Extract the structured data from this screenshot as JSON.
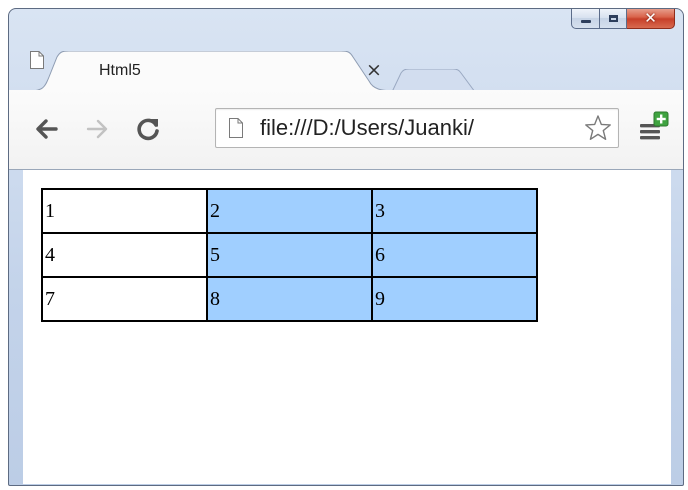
{
  "window": {
    "buttons": {
      "minimize": "minimize",
      "maximize": "maximize",
      "close": "close"
    }
  },
  "tab": {
    "title": "Html5",
    "close_glyph": "×",
    "icon": "page-icon"
  },
  "toolbar": {
    "back_icon": "back-arrow-icon",
    "forward_icon": "forward-arrow-icon",
    "reload_icon": "reload-icon",
    "url": "file:///D:/Users/Juanki/",
    "star_icon": "star-icon",
    "menu_icon": "chrome-menu-icon"
  },
  "page": {
    "table": {
      "rows": [
        [
          "1",
          "2",
          "3"
        ],
        [
          "4",
          "5",
          "6"
        ],
        [
          "7",
          "8",
          "9"
        ]
      ],
      "highlight_color": "#a0cfff",
      "highlighted_columns": [
        1,
        2
      ]
    }
  },
  "colors": {
    "close_button": "#c7402a",
    "highlight": "#a0cfff"
  }
}
